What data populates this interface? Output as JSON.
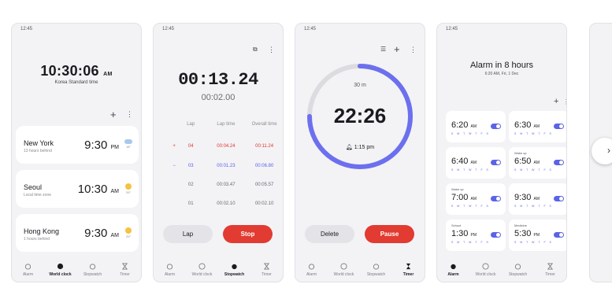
{
  "status_time": "12:45",
  "tabs": [
    "Alarm",
    "World clock",
    "Stopwatch",
    "Timer"
  ],
  "world_clock": {
    "time": "10:30:06",
    "ampm": "AM",
    "zone": "Korea Standard time",
    "cities": [
      {
        "name": "New York",
        "sub": "13 hours behind",
        "time": "9:30",
        "ampm": "PM",
        "temp": "18°",
        "weather": "cloud"
      },
      {
        "name": "Seoul",
        "sub": "Local time zone",
        "time": "10:30",
        "ampm": "AM",
        "temp": "29°",
        "weather": "sun"
      },
      {
        "name": "Hong Kong",
        "sub": "1 hours behind",
        "time": "9:30",
        "ampm": "AM",
        "temp": "29°",
        "weather": "sun"
      }
    ]
  },
  "stopwatch": {
    "main": "00:13.24",
    "lap_current": "00:02.00",
    "headers": [
      "Lap",
      "Lap time",
      "Overall time"
    ],
    "laps": [
      {
        "marker": "+",
        "lap": "04",
        "lap_time": "00:04.24",
        "overall": "00:11.24",
        "style": "red"
      },
      {
        "marker": "−",
        "lap": "03",
        "lap_time": "00:01.23",
        "overall": "00:06.80",
        "style": "blue"
      },
      {
        "marker": "",
        "lap": "02",
        "lap_time": "00:03.47",
        "overall": "00:05.57",
        "style": ""
      },
      {
        "marker": "",
        "lap": "01",
        "lap_time": "00:02.10",
        "overall": "00:02.10",
        "style": ""
      }
    ],
    "lap_button": "Lap",
    "stop_button": "Stop"
  },
  "timer": {
    "preset": "30 m",
    "main": "22:26",
    "alarm_at": "1:15 pm",
    "progress": 0.75,
    "delete_button": "Delete",
    "pause_button": "Pause"
  },
  "alarms": {
    "title": "Alarm in 8 hours",
    "subtitle": "6:20 AM, Fri, 1 Dec",
    "days": "S M T W T F S",
    "items": [
      {
        "label": "",
        "time": "6:20",
        "ampm": "AM"
      },
      {
        "label": "",
        "time": "6:30",
        "ampm": "AM"
      },
      {
        "label": "",
        "time": "6:40",
        "ampm": "AM"
      },
      {
        "label": "Wake up",
        "time": "6:50",
        "ampm": "AM"
      },
      {
        "label": "Wake up",
        "time": "7:00",
        "ampm": "AM"
      },
      {
        "label": "",
        "time": "9:30",
        "ampm": "AM"
      },
      {
        "label": "School",
        "time": "1:30",
        "ampm": "PM"
      },
      {
        "label": "Medicine",
        "time": "5:30",
        "ampm": "PM"
      }
    ]
  },
  "colors": {
    "accent": "#5b63e6",
    "red": "#e23b31",
    "card": "#ffffff",
    "background": "#f3f3f6"
  }
}
